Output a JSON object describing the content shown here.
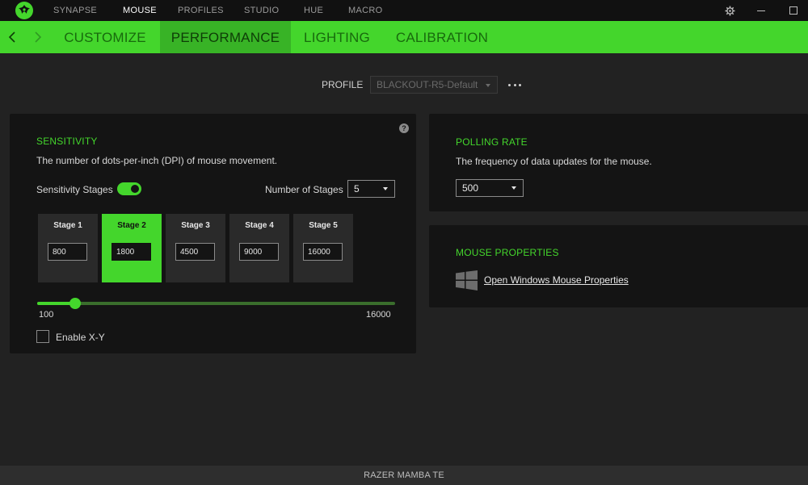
{
  "top_nav": {
    "items": [
      {
        "label": "SYNAPSE"
      },
      {
        "label": "MOUSE"
      },
      {
        "label": "PROFILES"
      },
      {
        "label": "STUDIO"
      },
      {
        "label": "HUE"
      },
      {
        "label": "MACRO"
      }
    ],
    "active": "MOUSE"
  },
  "sub_nav": {
    "tabs": [
      {
        "label": "CUSTOMIZE"
      },
      {
        "label": "PERFORMANCE"
      },
      {
        "label": "LIGHTING"
      },
      {
        "label": "CALIBRATION"
      }
    ],
    "active": "PERFORMANCE"
  },
  "profile": {
    "label": "PROFILE",
    "selected": "BLACKOUT-R5-Default"
  },
  "sensitivity": {
    "title": "SENSITIVITY",
    "description": "The number of dots-per-inch (DPI) of mouse movement.",
    "help": "?",
    "stages_label": "Sensitivity Stages",
    "stages_enabled": true,
    "num_stages_label": "Number of Stages",
    "num_stages": "5",
    "stages": [
      {
        "name": "Stage 1",
        "value": "800"
      },
      {
        "name": "Stage 2",
        "value": "1800"
      },
      {
        "name": "Stage 3",
        "value": "4500"
      },
      {
        "name": "Stage 4",
        "value": "9000"
      },
      {
        "name": "Stage 5",
        "value": "16000"
      }
    ],
    "active_stage": "Stage 2",
    "slider": {
      "min": "100",
      "max": "16000",
      "value": 1800
    },
    "enable_xy_label": "Enable X-Y",
    "enable_xy": false
  },
  "polling_rate": {
    "title": "POLLING RATE",
    "description": "The frequency of data updates for the mouse.",
    "selected": "500"
  },
  "mouse_properties": {
    "title": "MOUSE PROPERTIES",
    "link": "Open Windows Mouse Properties"
  },
  "footer": {
    "device_name": "RAZER MAMBA TE"
  },
  "colors": {
    "accent": "#44d62c",
    "background": "#222222",
    "panel": "#141414"
  }
}
